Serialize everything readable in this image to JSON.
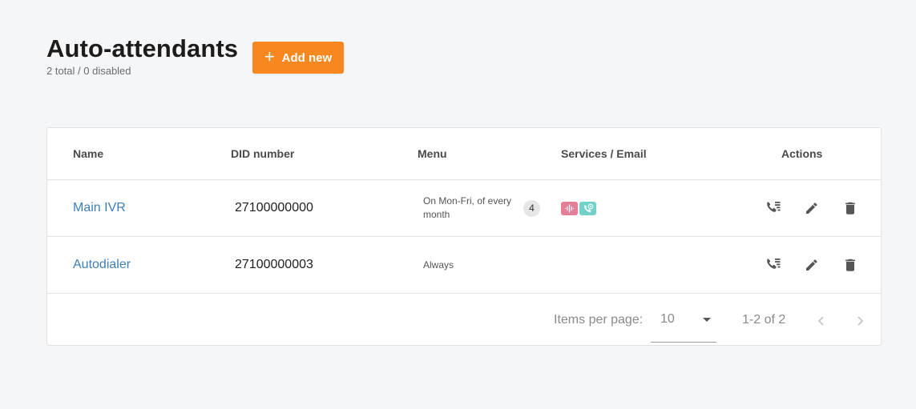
{
  "header": {
    "title": "Auto-attendants",
    "subtitle": "2 total / 0 disabled",
    "add_label": "Add new"
  },
  "table": {
    "columns": [
      "Name",
      "DID number",
      "Menu",
      "Services / Email",
      "Actions"
    ],
    "rows": [
      {
        "name": "Main IVR",
        "did": "27100000000",
        "menu": "On Mon-Fri, of every month",
        "menu_count": "4",
        "services": [
          "voice-recording-icon",
          "call-recording-icon"
        ]
      },
      {
        "name": "Autodialer",
        "did": "27100000003",
        "menu": "Always",
        "menu_count": "",
        "services": []
      }
    ],
    "actions": [
      "call-list-icon",
      "edit-icon",
      "delete-icon"
    ]
  },
  "pagination": {
    "items_per_page_label": "Items per page:",
    "items_per_page_value": "10",
    "range_label": "1-2 of 2"
  },
  "colors": {
    "accent": "#f7871f",
    "link": "#3e7fb5",
    "service_pink": "#e57f98",
    "service_teal": "#71d3c8"
  }
}
